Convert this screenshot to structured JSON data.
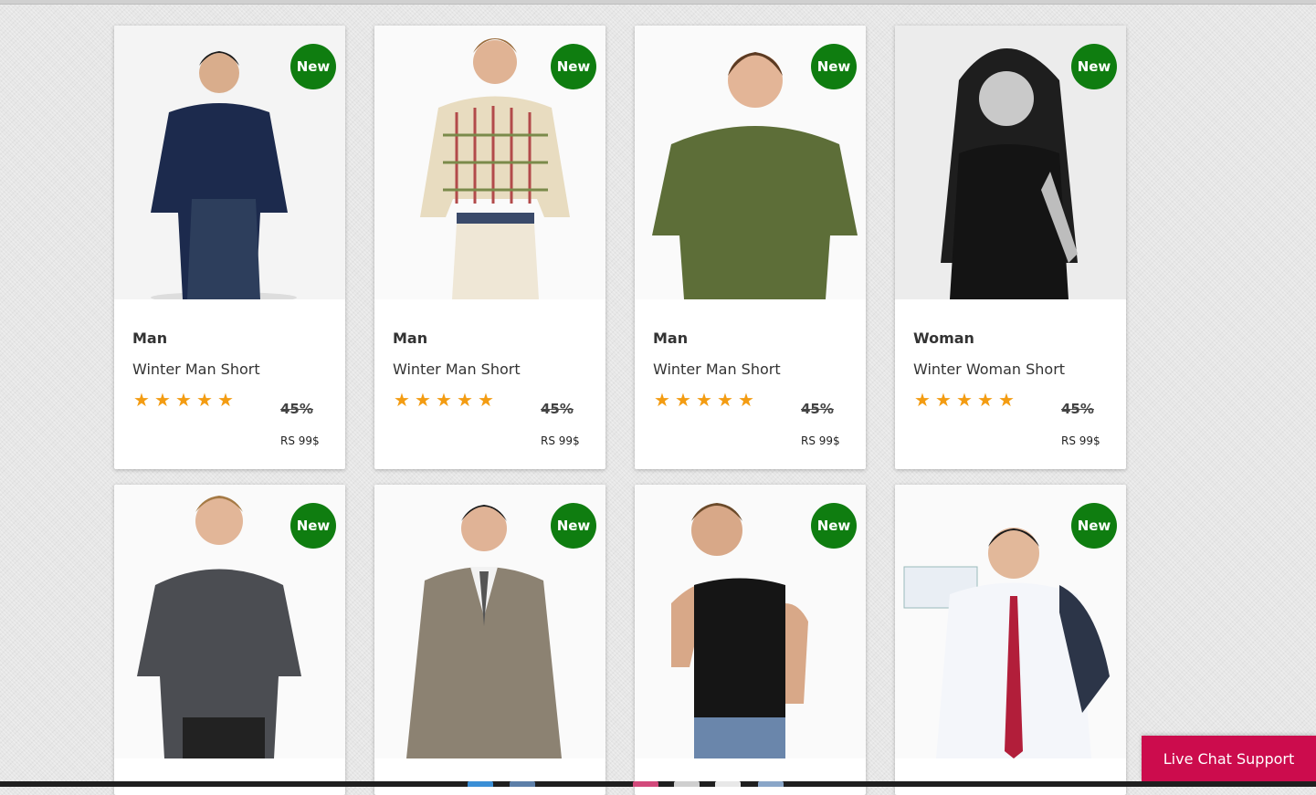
{
  "badge_color": "#0f7d10",
  "star_color": "#f39c12",
  "chat_color": "#cc0c4d",
  "products": [
    {
      "badge": "New",
      "category": "Man",
      "title": "Winter Man Short",
      "rating": 5,
      "star_glyph": "★",
      "discount": "45%",
      "price": "RS 99$",
      "image": "man-dark-shirt"
    },
    {
      "badge": "New",
      "category": "Man",
      "title": "Winter Man Short",
      "rating": 5,
      "star_glyph": "★",
      "discount": "45%",
      "price": "RS 99$",
      "image": "man-plaid-shirt"
    },
    {
      "badge": "New",
      "category": "Man",
      "title": "Winter Man Short",
      "rating": 5,
      "star_glyph": "★",
      "discount": "45%",
      "price": "RS 99$",
      "image": "man-green-tshirt"
    },
    {
      "badge": "New",
      "category": "Woman",
      "title": "Winter Woman Short",
      "rating": 5,
      "star_glyph": "★",
      "discount": "45%",
      "price": "RS 99$",
      "image": "woman-black-top"
    },
    {
      "badge": "New",
      "image": "man-grey-tshirt"
    },
    {
      "badge": "New",
      "image": "man-suit"
    },
    {
      "badge": "New",
      "image": "man-tank-top"
    },
    {
      "badge": "New",
      "image": "man-business-card"
    }
  ],
  "chat": {
    "label": "Live Chat Support"
  }
}
